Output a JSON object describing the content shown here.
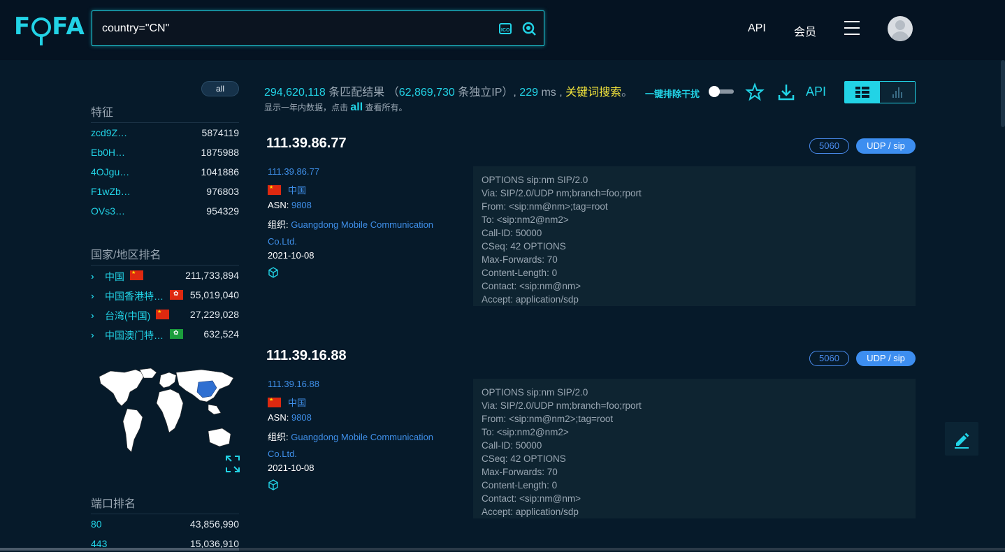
{
  "header": {
    "logo_left": "F",
    "logo_right": "FA",
    "search_value": "country=\"CN\"",
    "nav_api": "API",
    "nav_member": "会员"
  },
  "sidebar": {
    "all_label": "all",
    "features_title": "特征",
    "features": [
      {
        "key": "zcd9Z…",
        "count": "5874119"
      },
      {
        "key": "Eb0H…",
        "count": "1875988"
      },
      {
        "key": "4OJgu…",
        "count": "1041886"
      },
      {
        "key": "F1wZb…",
        "count": "976803"
      },
      {
        "key": "OVs3…",
        "count": "954329"
      }
    ],
    "country_title": "国家/地区排名",
    "countries": [
      {
        "name": "中国",
        "count": "211,733,894",
        "flag": "cn"
      },
      {
        "name": "中国香港特…",
        "count": "55,019,040",
        "flag": "hk"
      },
      {
        "name": "台湾(中国)",
        "count": "27,229,028",
        "flag": "cn"
      },
      {
        "name": "中国澳门特…",
        "count": "632,524",
        "flag": "mo"
      }
    ],
    "port_title": "端口排名",
    "ports": [
      {
        "port": "80",
        "count": "43,856,990"
      },
      {
        "port": "443",
        "count": "15,036,910"
      }
    ]
  },
  "summary": {
    "total": "294,620,118",
    "total_suffix": "条匹配结果",
    "unique_open": "（",
    "unique": "62,869,730",
    "unique_suffix": "条独立IP）,",
    "ms": "229",
    "ms_suffix": "ms ,",
    "keyword": "关键词搜索",
    "keyword_end": "。",
    "note_pre": "显示一年内数据，点击",
    "note_link": "all",
    "note_post": "查看所有。",
    "toggle_label": "一键排除干扰",
    "api_label": "API"
  },
  "results": [
    {
      "ip": "111.39.86.77",
      "link": "111.39.86.77",
      "country": "中国",
      "asn_label": "ASN:",
      "asn": "9808",
      "org_label": "组织:",
      "org": "Guangdong Mobile Communication Co.Ltd.",
      "date": "2021-10-08",
      "port": "5060",
      "protocol": "UDP / sip",
      "banner": [
        "OPTIONS sip:nm SIP/2.0",
        "Via: SIP/2.0/UDP nm;branch=foo;rport",
        "From: <sip:nm@nm>;tag=root",
        "To: <sip:nm2@nm2>",
        "Call-ID: 50000",
        "CSeq: 42 OPTIONS",
        "Max-Forwards: 70",
        "Content-Length: 0",
        "Contact: <sip:nm@nm>",
        "Accept: application/sdp"
      ]
    },
    {
      "ip": "111.39.16.88",
      "link": "111.39.16.88",
      "country": "中国",
      "asn_label": "ASN:",
      "asn": "9808",
      "org_label": "组织:",
      "org": "Guangdong Mobile Communication Co.Ltd.",
      "date": "2021-10-08",
      "port": "5060",
      "protocol": "UDP / sip",
      "banner": [
        "OPTIONS sip:nm SIP/2.0",
        "Via: SIP/2.0/UDP nm;branch=foo;rport",
        "From: <sip:nm@nm2>;tag=root",
        "To: <sip:nm2@nm2>",
        "Call-ID: 50000",
        "CSeq: 42 OPTIONS",
        "Max-Forwards: 70",
        "Content-Length: 0",
        "Contact: <sip:nm@nm>",
        "Accept: application/sdp"
      ]
    }
  ],
  "colors": {
    "accent": "#22d3e6",
    "link": "#3f8fe8",
    "keyword": "#f5e63b",
    "background": "#061a2a"
  }
}
